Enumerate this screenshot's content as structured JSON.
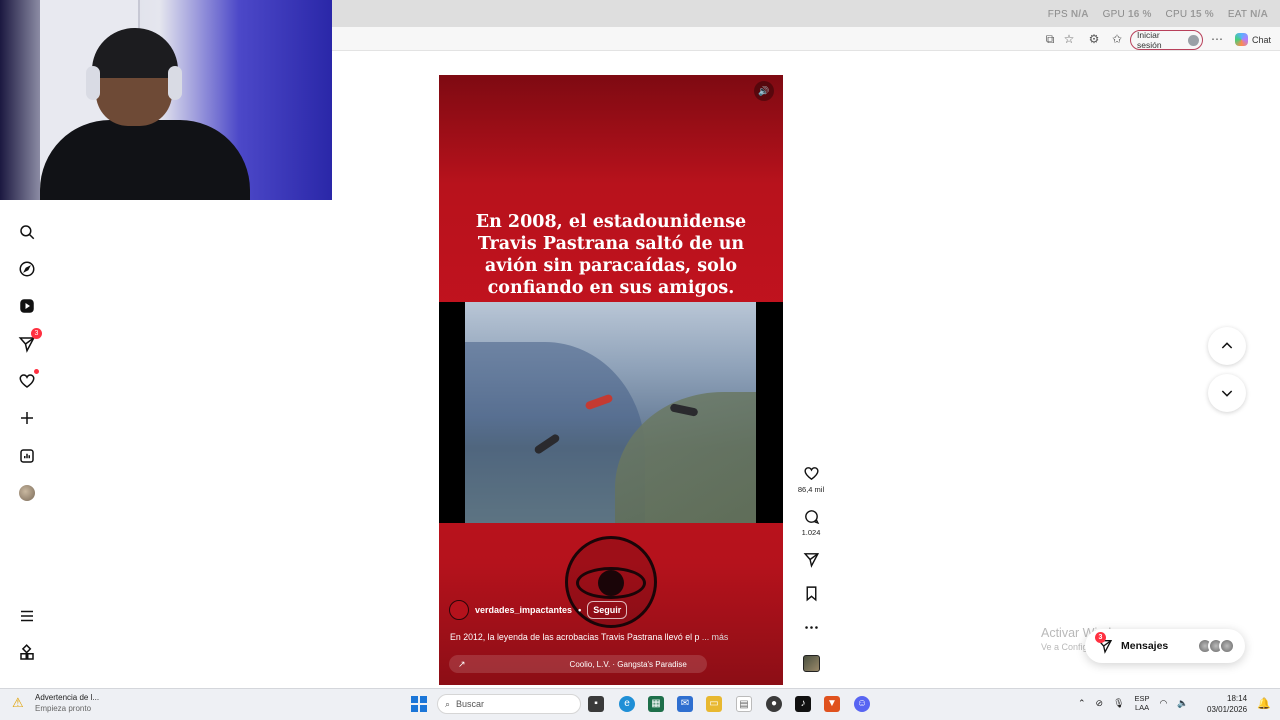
{
  "browser": {
    "overlay_stats": [
      {
        "label": "FPS",
        "value": "N/A"
      },
      {
        "label": "GPU",
        "value": "16 %"
      },
      {
        "label": "CPU",
        "value": "15 %"
      },
      {
        "label": "EAT",
        "value": "N/A"
      }
    ],
    "signin_label": "Iniciar sesión",
    "copilot_label": "Chat"
  },
  "sidebar": {
    "items": [
      {
        "name": "search",
        "icon": "search-icon"
      },
      {
        "name": "explore",
        "icon": "compass-icon"
      },
      {
        "name": "reels",
        "icon": "reels-icon"
      },
      {
        "name": "messages",
        "icon": "send-icon",
        "badge": "3"
      },
      {
        "name": "notifications",
        "icon": "heart-icon",
        "dot": true
      },
      {
        "name": "create",
        "icon": "plus-icon"
      },
      {
        "name": "dashboard",
        "icon": "chart-icon"
      },
      {
        "name": "profile",
        "icon": "avatar"
      }
    ],
    "bottom": [
      {
        "name": "more",
        "icon": "hamburger-icon"
      },
      {
        "name": "also-from-meta",
        "icon": "grid-icon"
      }
    ]
  },
  "reel": {
    "caption": "En 2008, el estadounidense Travis Pastrana saltó de un avión sin paracaídas, solo confiando en sus amigos.",
    "username": "verdades_impactantes",
    "separator": "•",
    "follow_label": "Seguir",
    "description": "En 2012, la leyenda de las acrobacias Travis Pastrana llevó el p",
    "more_label": "... más",
    "music": "Coolio, L.V. · Gangsta's Paradise",
    "accent_color": "#c4131f"
  },
  "actions": {
    "likes": "86,4 mil",
    "comments": "1.024"
  },
  "windows": {
    "activate_title": "Activar Windows",
    "activate_sub": "Ve a Configuración para activar Windows."
  },
  "messages_pill": {
    "label": "Mensajes",
    "badge": "3"
  },
  "taskbar": {
    "weather_title": "Advertencia de l...",
    "weather_sub": "Empieza pronto",
    "search_placeholder": "Buscar",
    "lang_1": "ESP",
    "lang_2": "LAA",
    "time": "18:14",
    "date": "03/01/2026"
  }
}
